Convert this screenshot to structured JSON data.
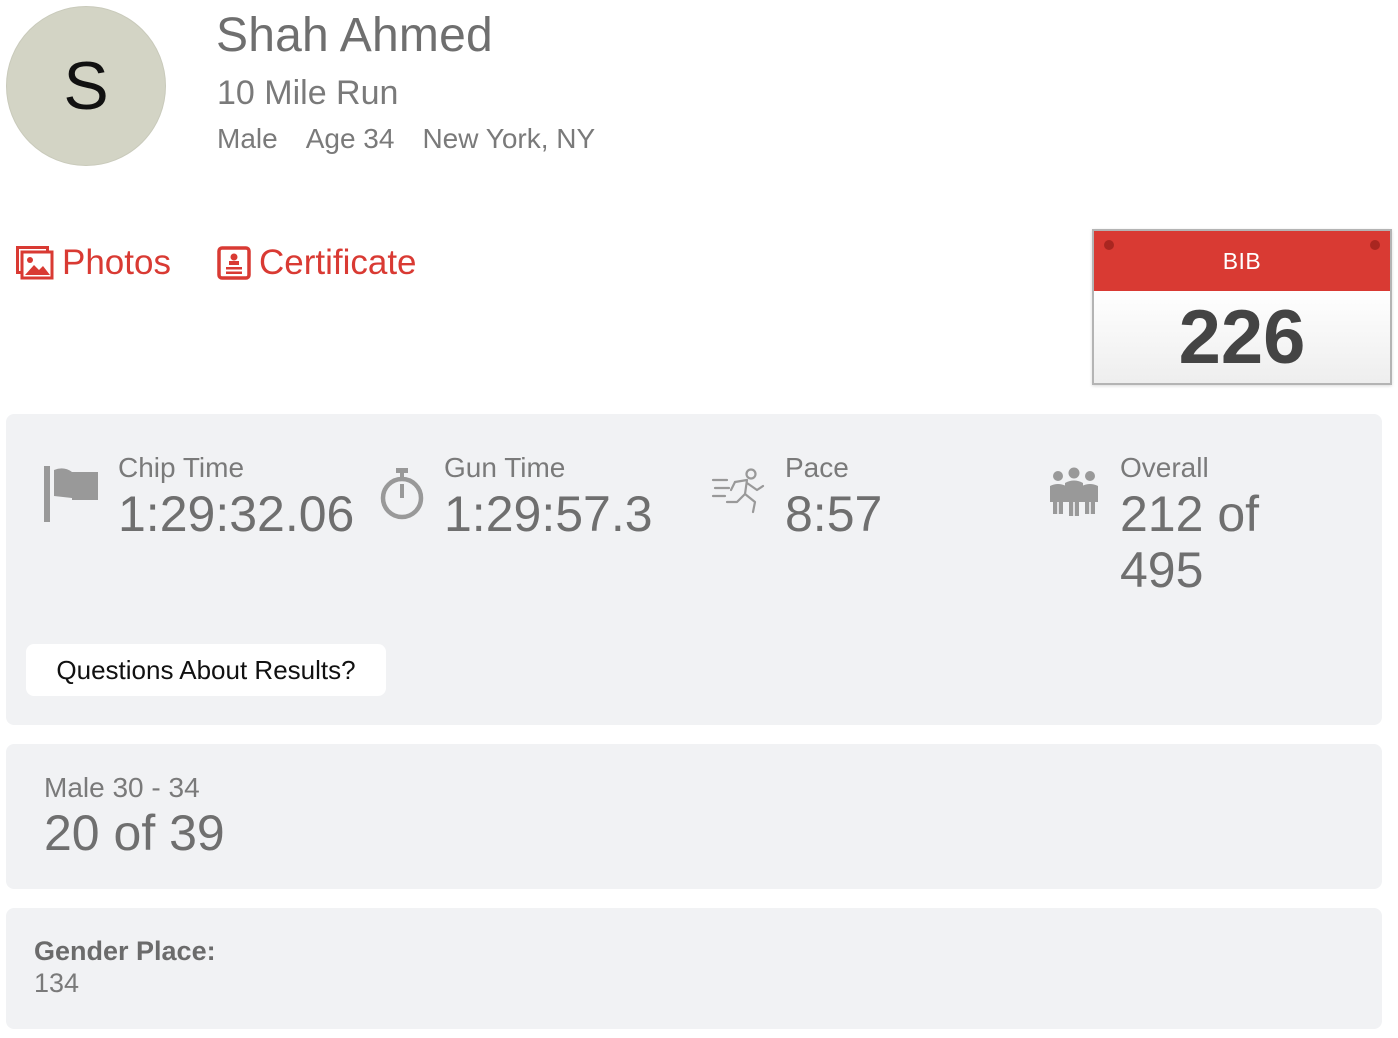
{
  "profile": {
    "initial": "S",
    "name": "Shah Ahmed",
    "event": "10 Mile Run",
    "gender": "Male",
    "age": "Age 34",
    "location": "New York, NY"
  },
  "links": {
    "photos": "Photos",
    "certificate": "Certificate"
  },
  "bib": {
    "label": "BIB",
    "number": "226"
  },
  "stats": {
    "chip": {
      "label": "Chip Time",
      "value": "1:29:32.06",
      "icon": "flag-icon"
    },
    "gun": {
      "label": "Gun Time",
      "value": "1:29:57.3",
      "icon": "stopwatch-icon"
    },
    "pace": {
      "label": "Pace",
      "value": "8:57",
      "icon": "runner-icon"
    },
    "overall": {
      "label": "Overall",
      "value": "212 of 495",
      "icon": "group-icon"
    }
  },
  "questions_button": "Questions About Results?",
  "division": {
    "label": "Male 30 - 34",
    "value": "20 of 39"
  },
  "gender_place": {
    "label": "Gender Place:",
    "value": "134"
  },
  "colors": {
    "accent": "#d93a33",
    "panel": "#f1f2f4",
    "avatar": "#d3d4c5"
  }
}
